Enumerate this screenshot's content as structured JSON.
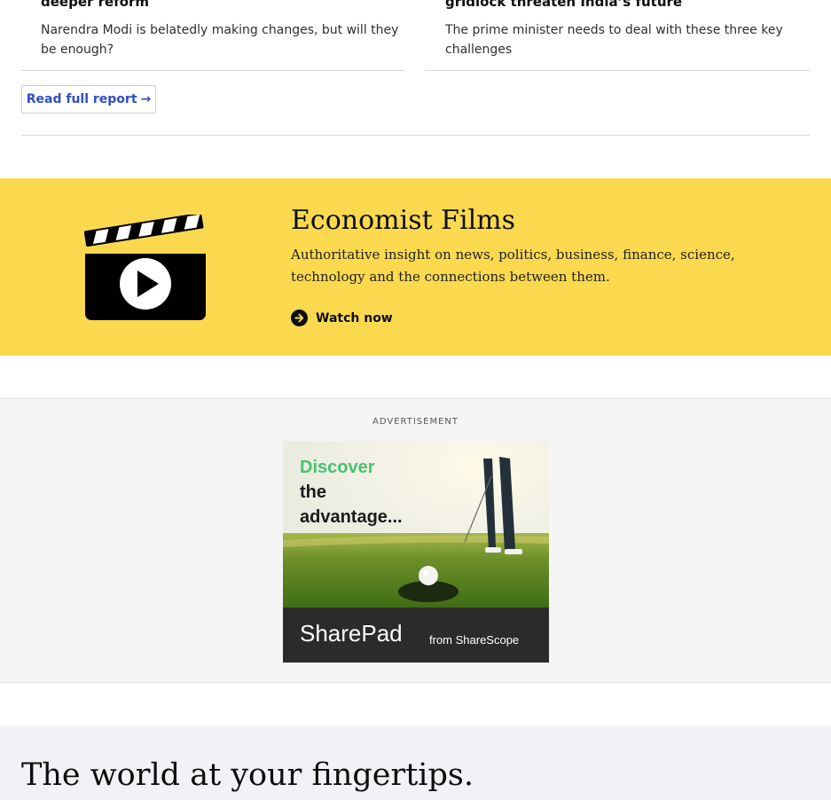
{
  "cards": [
    {
      "title": "deeper reform",
      "description": "Narendra Modi is belatedly making changes, but will they be enough?"
    },
    {
      "title": "gridlock threaten India’s future",
      "description": "The prime minister needs to deal with these three key challenges"
    }
  ],
  "read_report": {
    "label": "Read full report",
    "icon": "arrow-right-icon"
  },
  "films": {
    "title": "Economist Films",
    "description": "Authoritative insight on news, politics, business, finance, science, technology and the connections between them.",
    "watch_label": "Watch now",
    "icon": "clapperboard-play-icon",
    "background": "#fbd94f"
  },
  "advertisement": {
    "label": "ADVERTISEMENT",
    "headline": [
      "Discover",
      "the",
      "advantage..."
    ],
    "brand": "SharePad",
    "brand_from": "from ShareScope",
    "accent": "#48c36f"
  },
  "bottom": {
    "title": "The world at your fingertips."
  }
}
